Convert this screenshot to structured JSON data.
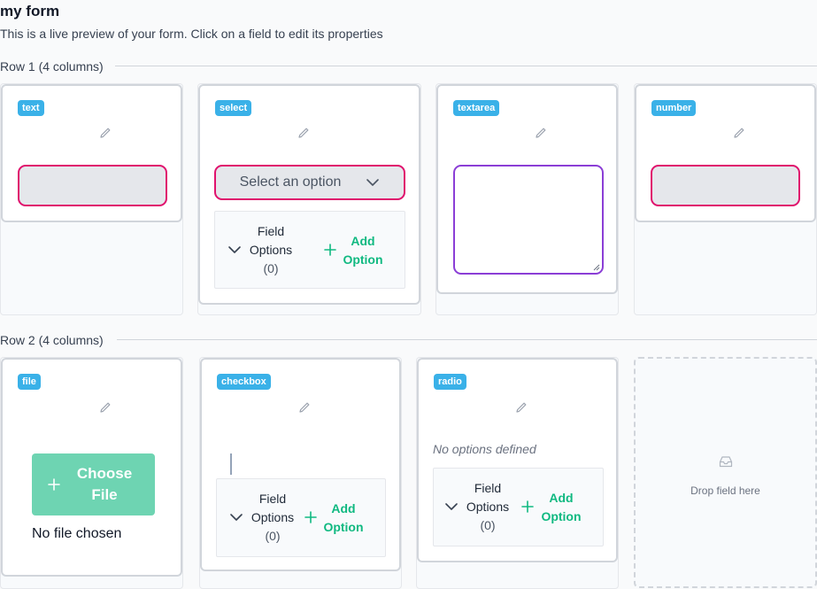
{
  "form": {
    "title": "my form",
    "subtitle": "This is a live preview of your form. Click on a field to edit its properties"
  },
  "rows": [
    {
      "label": "Row 1 (4 columns)",
      "fields": [
        {
          "type": "text"
        },
        {
          "type": "select",
          "placeholder": "Select an option",
          "options_label_1": "Field",
          "options_label_2": "Options",
          "options_count": "(0)",
          "add_label_1": "Add",
          "add_label_2": "Option"
        },
        {
          "type": "textarea"
        },
        {
          "type": "number"
        }
      ]
    },
    {
      "label": "Row 2 (4 columns)",
      "fields": [
        {
          "type": "file",
          "button_label_1": "Choose",
          "button_label_2": "File",
          "status": "No file chosen"
        },
        {
          "type": "checkbox",
          "options_label_1": "Field",
          "options_label_2": "Options",
          "options_count": "(0)",
          "add_label_1": "Add",
          "add_label_2": "Option"
        },
        {
          "type": "radio",
          "empty_text": "No options defined",
          "options_label_1": "Field",
          "options_label_2": "Options",
          "options_count": "(0)",
          "add_label_1": "Add",
          "add_label_2": "Option"
        }
      ],
      "dropzone": "Drop field here"
    }
  ],
  "icons": [
    "pencil-icon",
    "chevron-down-icon",
    "plus-icon",
    "inbox-icon"
  ],
  "colors": {
    "badge": "#3ab1e8",
    "accent": "#10b981",
    "error_border": "#e0126d",
    "focus_border": "#8b3ed6"
  }
}
